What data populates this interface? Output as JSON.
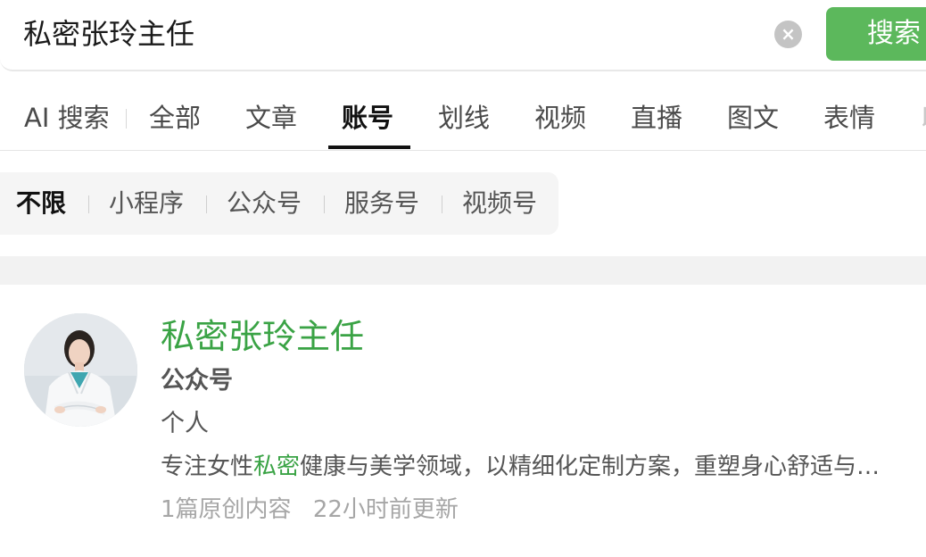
{
  "search": {
    "query": "私密张玲主任",
    "clear_icon": "clear-icon",
    "button_label": "搜索",
    "button_color": "#5cb85c"
  },
  "tabs": [
    {
      "label": "AI 搜索"
    },
    {
      "label": "全部"
    },
    {
      "label": "文章"
    },
    {
      "label": "账号",
      "active": true
    },
    {
      "label": "划线"
    },
    {
      "label": "视频"
    },
    {
      "label": "直播"
    },
    {
      "label": "图文"
    },
    {
      "label": "表情"
    },
    {
      "label": "以"
    }
  ],
  "filters": [
    {
      "label": "不限",
      "active": true
    },
    {
      "label": "小程序"
    },
    {
      "label": "公众号"
    },
    {
      "label": "服务号"
    },
    {
      "label": "视频号"
    }
  ],
  "result": {
    "avatar_icon": "doctor-avatar",
    "name": "私密张玲主任",
    "type": "公众号",
    "subtype": "个人",
    "desc_prefix": "专注女性",
    "desc_highlight": "私密",
    "desc_suffix": "健康与美学领域，以精细化定制方案，重塑身心舒适与…",
    "original_count": "1篇原创内容",
    "updated": "22小时前更新",
    "accent_color": "#3aa345"
  }
}
